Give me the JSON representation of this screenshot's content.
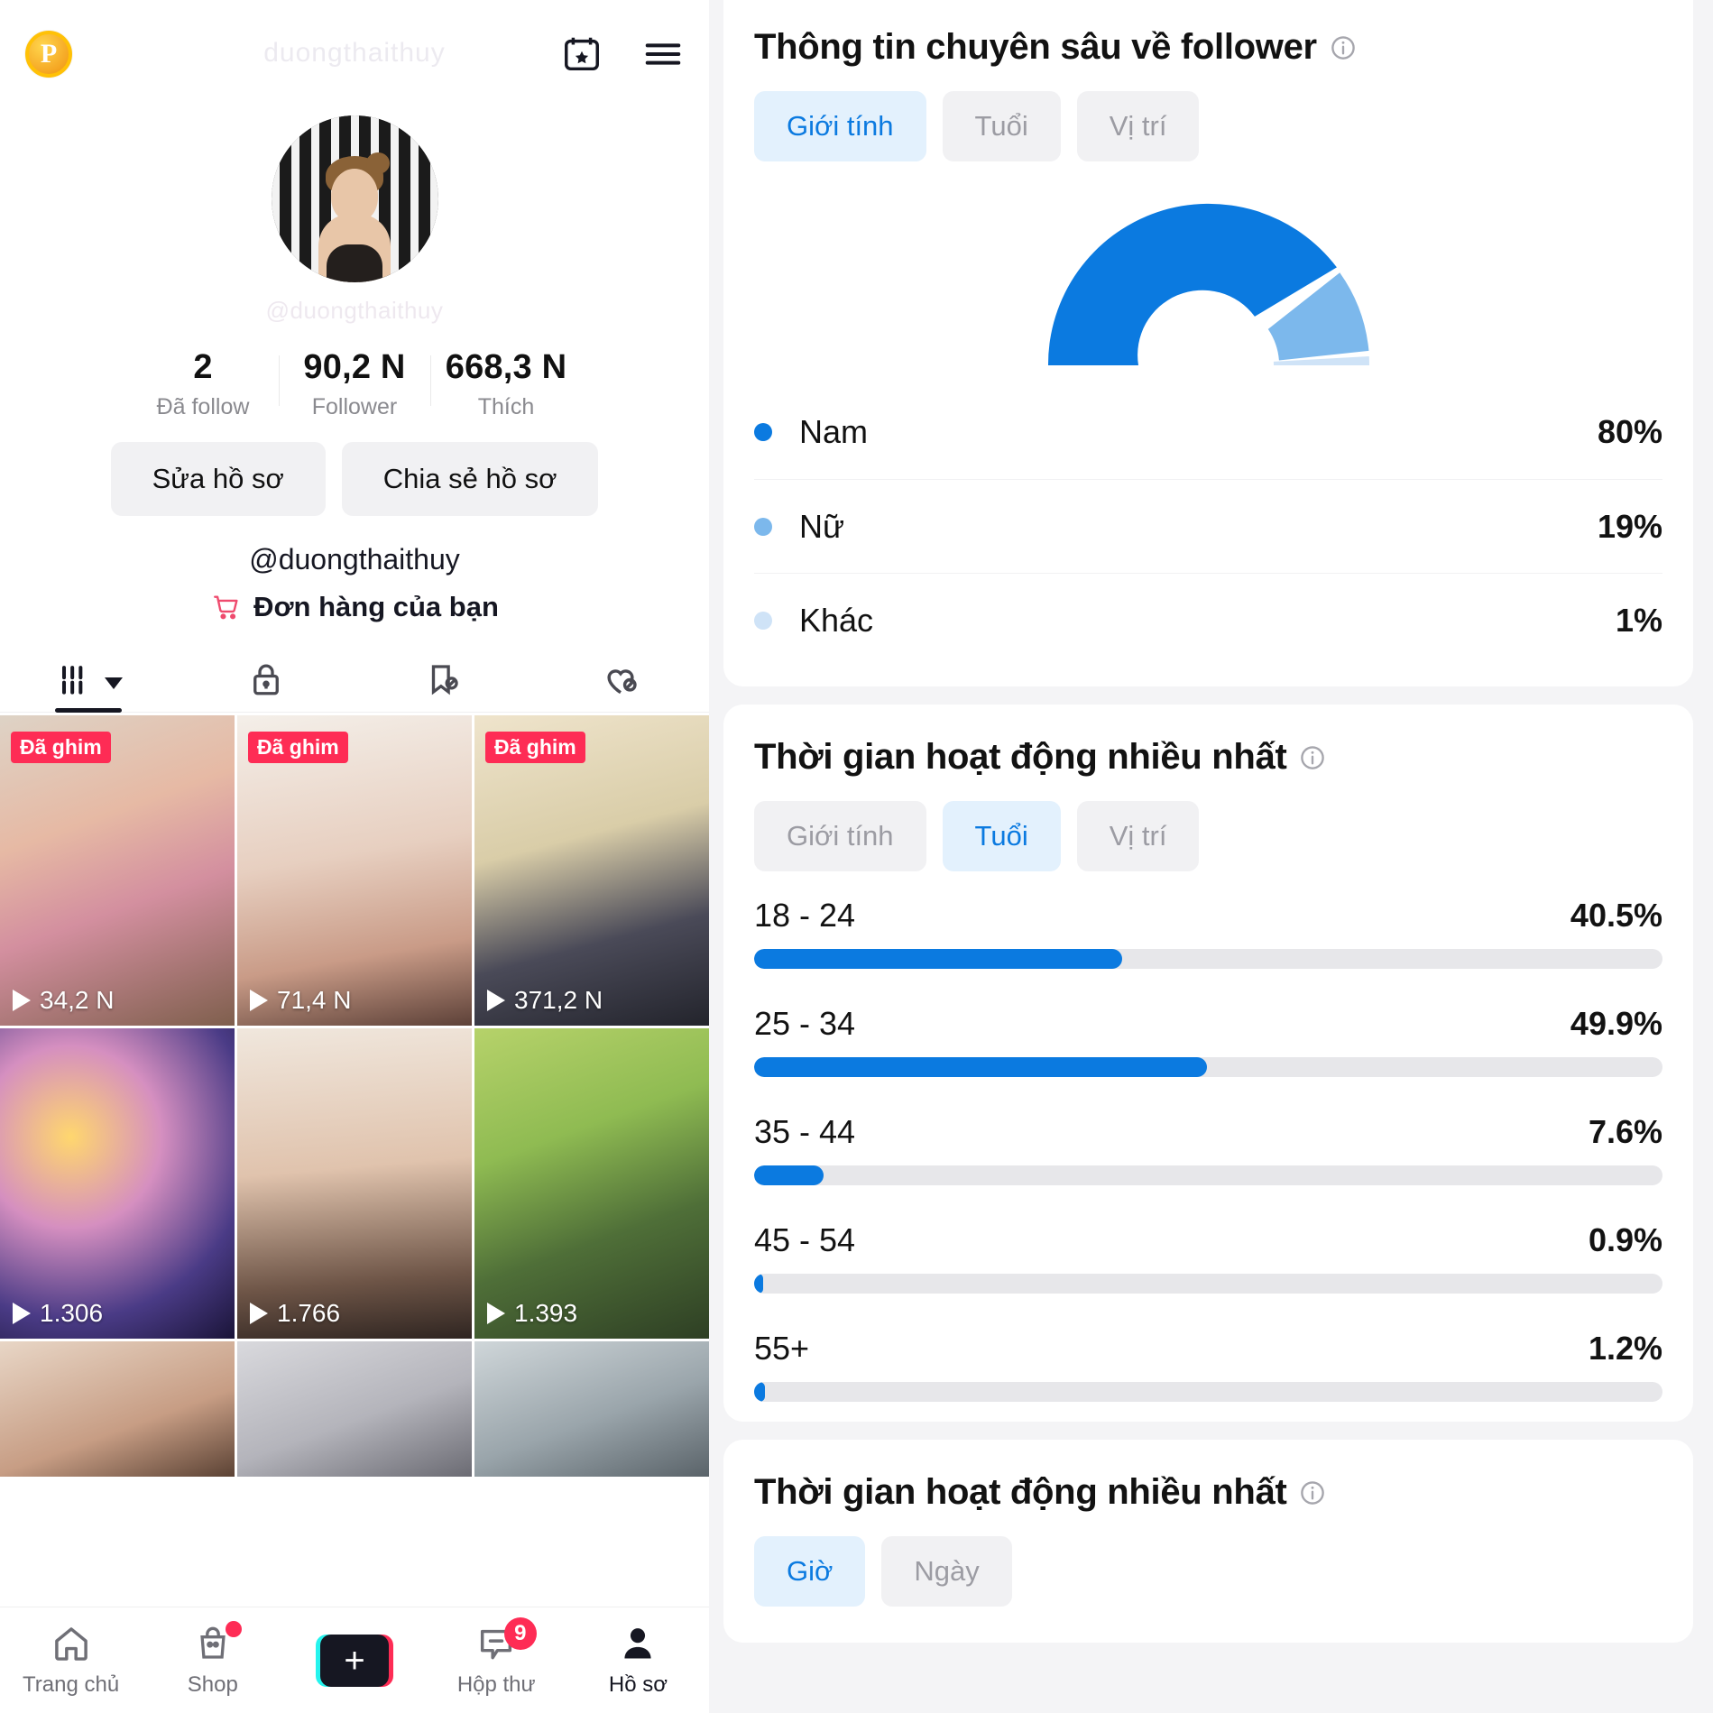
{
  "left": {
    "coin_badge": "P",
    "ghost_title": "duongthaithuy",
    "icons": {
      "calendar_star": "calendar-star-icon",
      "menu": "hamburger-menu-icon"
    },
    "ghost_handle": "@duongthaithuy",
    "stats": [
      {
        "num": "2",
        "label": "Đã follow"
      },
      {
        "num": "90,2 N",
        "label": "Follower"
      },
      {
        "num": "668,3 N",
        "label": "Thích"
      }
    ],
    "buttons": {
      "edit_profile": "Sửa hồ sơ",
      "share_profile": "Chia sẻ hồ sơ"
    },
    "handle": "@duongthaithuy",
    "orders_label": "Đơn hàng của bạn",
    "tabs": [
      {
        "icon": "grid-posts-icon",
        "active": true
      },
      {
        "icon": "lock-private-icon",
        "active": false
      },
      {
        "icon": "bookmark-hidden-icon",
        "active": false
      },
      {
        "icon": "heart-hidden-icon",
        "active": false
      }
    ],
    "videos": [
      {
        "pin": "Đã ghim",
        "views": "34,2 N"
      },
      {
        "pin": "Đã ghim",
        "views": "71,4 N"
      },
      {
        "pin": "Đã ghim",
        "views": "371,2 N"
      },
      {
        "pin": "",
        "views": "1.306"
      },
      {
        "pin": "",
        "views": "1.766"
      },
      {
        "pin": "",
        "views": "1.393"
      },
      {
        "pin": "",
        "views": ""
      },
      {
        "pin": "",
        "views": ""
      },
      {
        "pin": "",
        "views": ""
      }
    ],
    "nav": [
      {
        "label": "Trang chủ",
        "icon": "home-icon",
        "badge": "",
        "active": false
      },
      {
        "label": "Shop",
        "icon": "shop-bag-icon",
        "badge": "dot",
        "active": false
      },
      {
        "label": "",
        "icon": "create-plus-icon",
        "badge": "",
        "active": false
      },
      {
        "label": "Hộp thư",
        "icon": "inbox-message-icon",
        "badge": "9",
        "active": false
      },
      {
        "label": "Hồ sơ",
        "icon": "profile-person-icon",
        "badge": "",
        "active": true
      }
    ]
  },
  "right": {
    "follower_card": {
      "title": "Thông tin chuyên sâu về follower",
      "info_icon": "info-circle-icon",
      "segments": [
        {
          "label": "Giới tính",
          "selected": true
        },
        {
          "label": "Tuổi",
          "selected": false
        },
        {
          "label": "Vị trí",
          "selected": false
        }
      ]
    },
    "activity_age_card": {
      "title": "Thời gian hoạt động nhiều nhất",
      "info_icon": "info-circle-icon",
      "segments": [
        {
          "label": "Giới tính",
          "selected": false
        },
        {
          "label": "Tuổi",
          "selected": true
        },
        {
          "label": "Vị trí",
          "selected": false
        }
      ]
    },
    "activity_time_card": {
      "title": "Thời gian hoạt động nhiều nhất",
      "info_icon": "info-circle-icon",
      "segments": [
        {
          "label": "Giờ",
          "selected": true
        },
        {
          "label": "Ngày",
          "selected": false
        }
      ]
    }
  },
  "chart_data": [
    {
      "type": "pie",
      "title": "Thông tin chuyên sâu về follower",
      "subtype": "half-donut-gauge",
      "categories": [
        "Nam",
        "Nữ",
        "Khác"
      ],
      "values": [
        80,
        19,
        1
      ],
      "labels": [
        "80%",
        "19%",
        "1%"
      ],
      "colors": [
        "#0b7ae0",
        "#7cb8ec",
        "#cfe3f7"
      ],
      "legend": "below",
      "unit": "%"
    },
    {
      "type": "bar",
      "orientation": "horizontal",
      "title": "Thời gian hoạt động nhiều nhất",
      "categories": [
        "18 - 24",
        "25 - 34",
        "35 - 44",
        "45 - 54",
        "55+"
      ],
      "values": [
        40.5,
        49.9,
        7.6,
        0.9,
        1.2
      ],
      "labels": [
        "40.5%",
        "49.9%",
        "7.6%",
        "0.9%",
        "1.2%"
      ],
      "xlabel": "",
      "ylabel": "",
      "xlim": [
        0,
        100
      ],
      "grid": false,
      "bar_color": "#0b7ae0",
      "track_color": "#e7e7ea"
    }
  ]
}
